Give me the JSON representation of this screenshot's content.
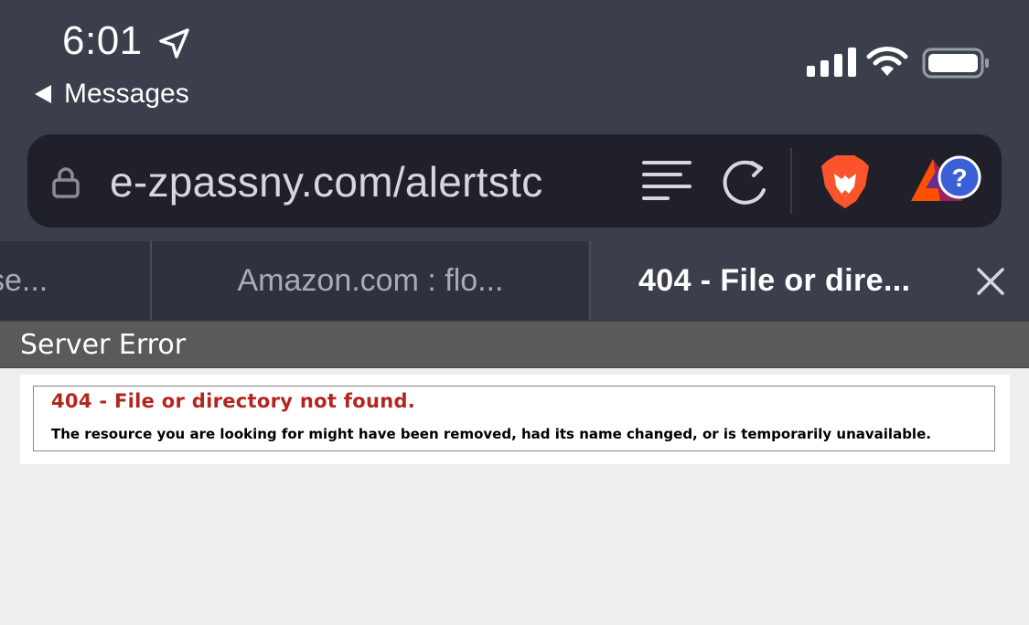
{
  "status_bar": {
    "time": "6:01",
    "back_label": "Messages"
  },
  "address_bar": {
    "url": "e-zpassny.com/alertstc"
  },
  "tabs": [
    {
      "label": "se..."
    },
    {
      "label": "Amazon.com : flo..."
    },
    {
      "label": "404 - File or dire..."
    }
  ],
  "page": {
    "header": "Server Error",
    "error_title": "404 - File or directory not found.",
    "error_message": "The resource you are looking for might have been removed, had its name changed, or is temporarily unavailable."
  },
  "colors": {
    "chrome": "#3b3f4c",
    "url_bar": "#1f2029",
    "error_red": "#b3261e",
    "header_gray": "#5a5a5a",
    "brave_orange": "#fb542b"
  },
  "icons": [
    "location-arrow-icon",
    "back-triangle-icon",
    "signal-icon",
    "wifi-icon",
    "battery-icon",
    "lock-icon",
    "reader-mode-icon",
    "reload-icon",
    "brave-lion-icon",
    "bat-rewards-icon",
    "close-icon"
  ]
}
